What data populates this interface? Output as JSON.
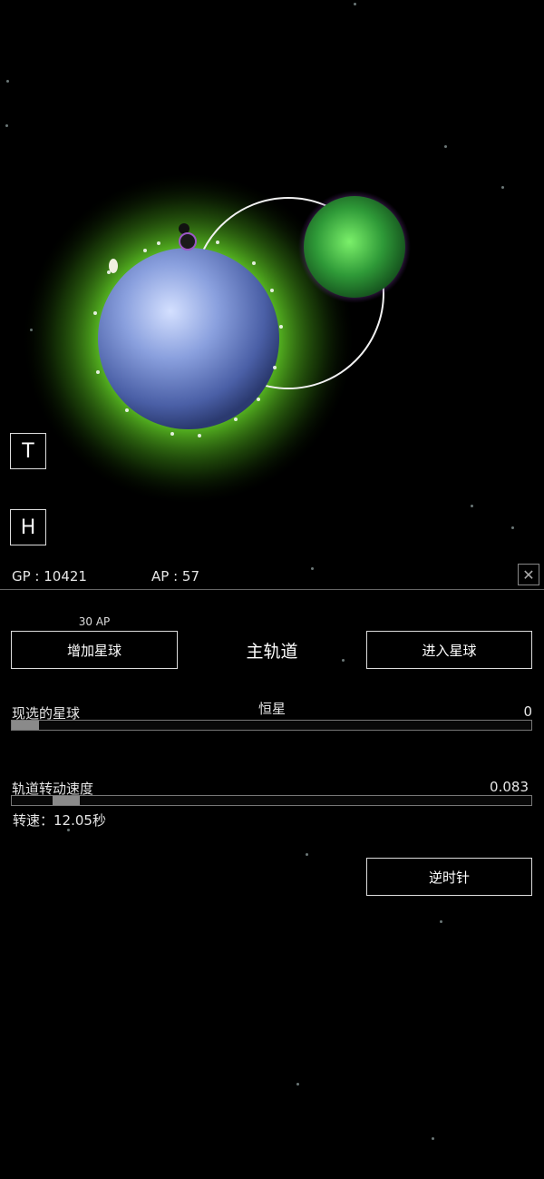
{
  "hud": {
    "t_button": "T",
    "h_button": "H",
    "gp_label": "GP : 10421",
    "ap_label": "AP : 57",
    "close_icon": "close-icon"
  },
  "panel": {
    "add_cost": "30 AP",
    "add_button": "增加星球",
    "orbit_title": "主轨道",
    "enter_button": "进入星球",
    "selected_label": "现选的星球",
    "selected_name": "恒星",
    "selected_value": "0",
    "selected_fill": 0.0,
    "speed_label": "轨道转动速度",
    "speed_value": "0.083",
    "rotation_label": "转速：12.05秒",
    "direction_button": "逆时针"
  },
  "colors": {
    "background": "#000000",
    "glow": "#7cff30",
    "blue_planet": "#8fa8e8",
    "green_planet": "#3fae3f",
    "corona": "#a060d0"
  }
}
